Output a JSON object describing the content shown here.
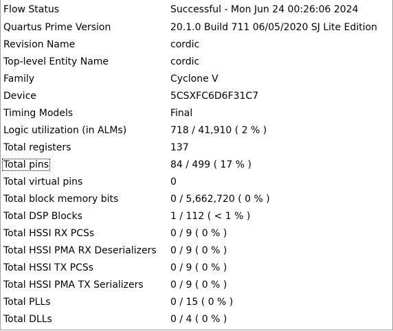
{
  "rows": [
    {
      "label": "Flow Status",
      "value": "Successful - Mon Jun 24 00:26:06 2024"
    },
    {
      "label": "Quartus Prime Version",
      "value": "20.1.0 Build 711 06/05/2020 SJ Lite Edition"
    },
    {
      "label": "Revision Name",
      "value": "cordic"
    },
    {
      "label": "Top-level Entity Name",
      "value": "cordic"
    },
    {
      "label": "Family",
      "value": "Cyclone V"
    },
    {
      "label": "Device",
      "value": "5CSXFC6D6F31C7"
    },
    {
      "label": "Timing Models",
      "value": "Final"
    },
    {
      "label": "Logic utilization (in ALMs)",
      "value": "718 / 41,910 ( 2 % )"
    },
    {
      "label": "Total registers",
      "value": "137"
    },
    {
      "label": "Total pins",
      "value": "84 / 499 ( 17 % )"
    },
    {
      "label": "Total virtual pins",
      "value": "0"
    },
    {
      "label": "Total block memory bits",
      "value": "0 / 5,662,720 ( 0 % )"
    },
    {
      "label": "Total DSP Blocks",
      "value": "1 / 112 ( < 1 % )"
    },
    {
      "label": "Total HSSI RX PCSs",
      "value": "0 / 9 ( 0 % )"
    },
    {
      "label": "Total HSSI PMA RX Deserializers",
      "value": "0 / 9 ( 0 % )"
    },
    {
      "label": "Total HSSI TX PCSs",
      "value": "0 / 9 ( 0 % )"
    },
    {
      "label": "Total HSSI PMA TX Serializers",
      "value": "0 / 9 ( 0 % )"
    },
    {
      "label": "Total PLLs",
      "value": "0 / 15 ( 0 % )"
    },
    {
      "label": "Total DLLs",
      "value": "0 / 4 ( 0 % )"
    }
  ],
  "colors": {
    "background": "#ffffff",
    "text": "#000000",
    "border": "#a0a0a0"
  },
  "focused_row_label": "Total pins"
}
